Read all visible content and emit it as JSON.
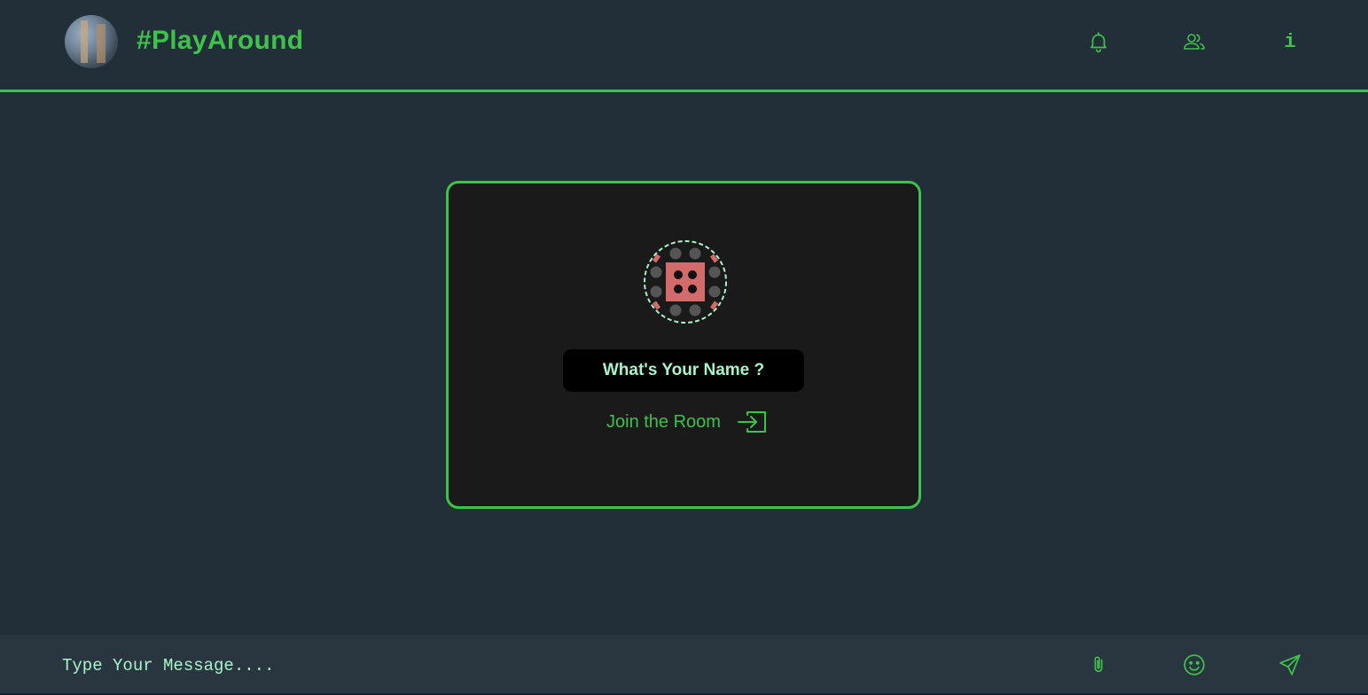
{
  "header": {
    "title": "#PlayAround",
    "avatar_icon": "avatar-photo",
    "icons": [
      "bell-icon",
      "users-icon",
      "info-icon"
    ],
    "info_glyph": "i"
  },
  "login_card": {
    "logo_icon": "dice-logo-icon",
    "name_placeholder": "What's Your Name ?",
    "join_label": "Join the Room",
    "join_icon": "enter-icon"
  },
  "footer": {
    "message_placeholder": "Type Your Message....",
    "icons": [
      "paperclip-icon",
      "smiley-icon",
      "send-icon"
    ]
  },
  "colors": {
    "accent": "#3fc24b",
    "background": "#222e38",
    "card_background": "#1a1a1a",
    "input_text": "#a9f3c8",
    "dice_red": "#d46a6a"
  }
}
